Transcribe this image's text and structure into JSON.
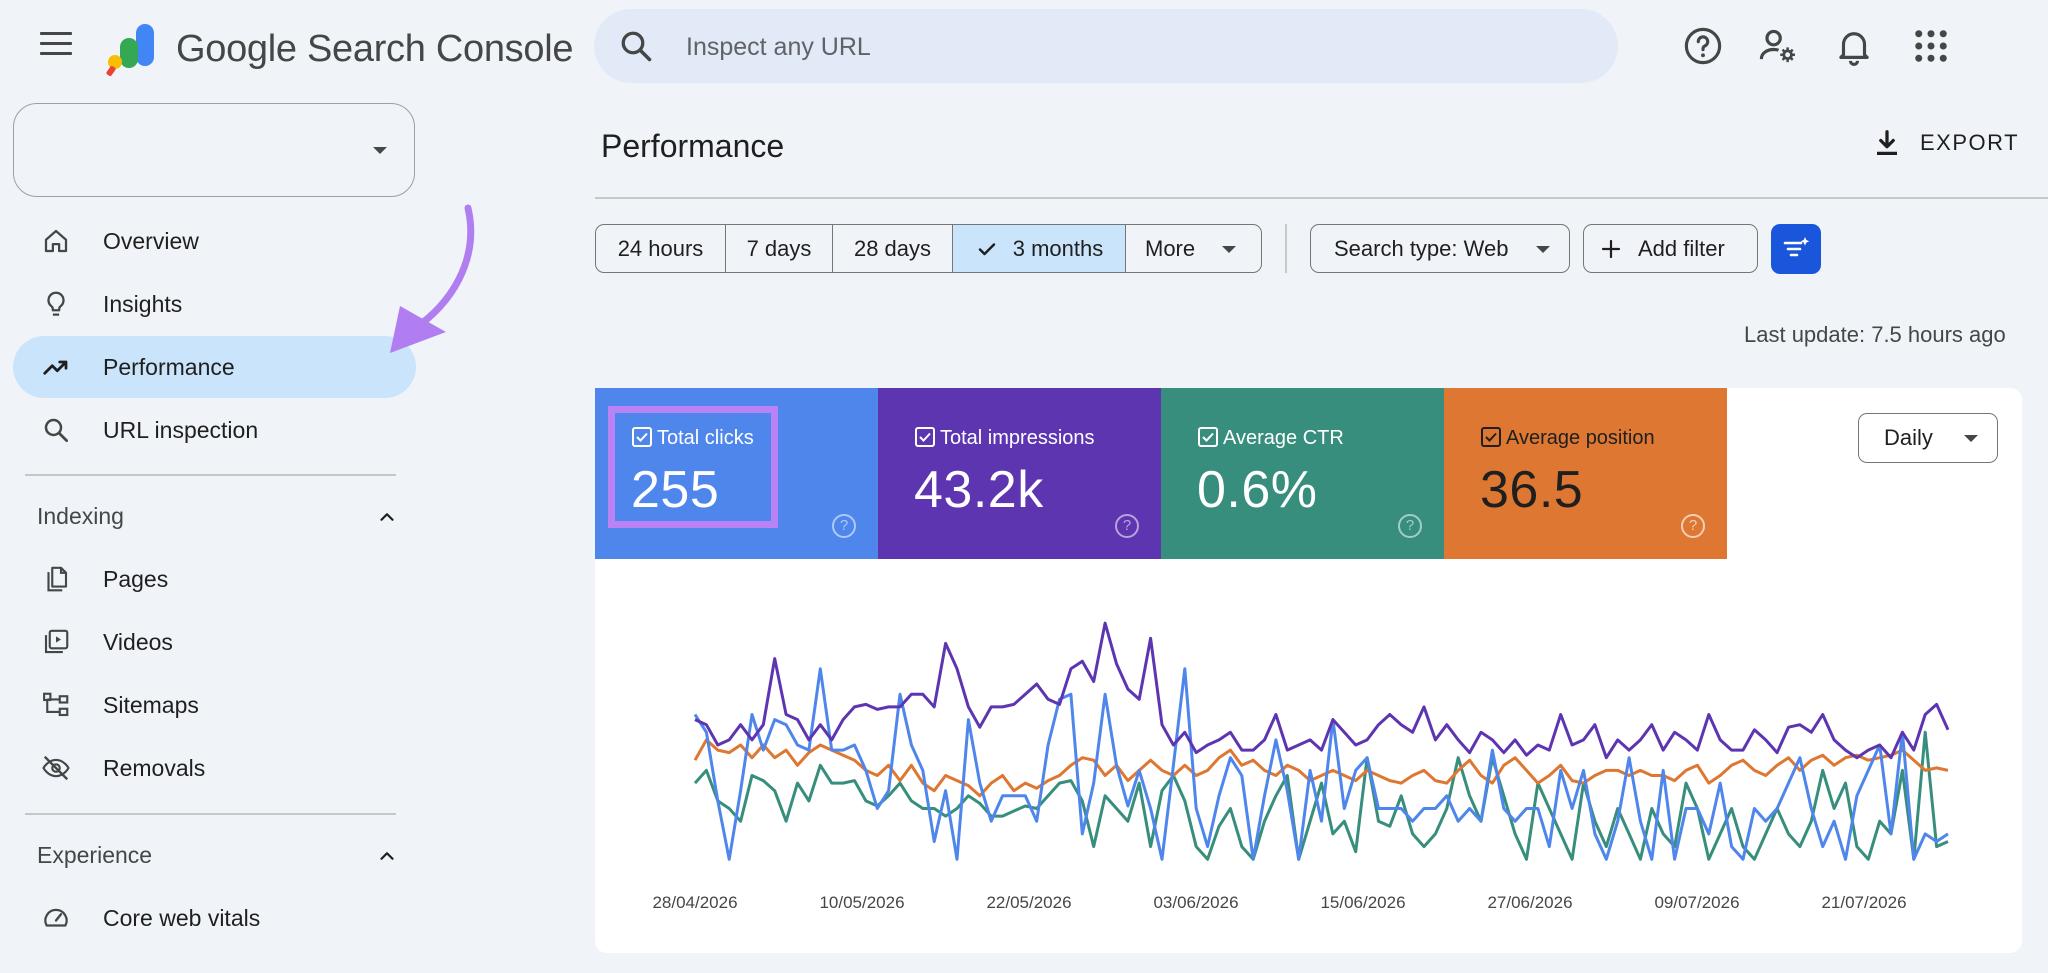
{
  "header": {
    "brand": "Google Search Console",
    "search_placeholder": "Inspect any URL",
    "icons": [
      "menu-icon",
      "help-icon",
      "manage-accounts-icon",
      "bell-icon",
      "apps-grid-icon"
    ]
  },
  "sidebar": {
    "property_value": "",
    "items": [
      {
        "label": "Overview",
        "icon": "home-icon",
        "active": false
      },
      {
        "label": "Insights",
        "icon": "lightbulb-icon",
        "active": false
      },
      {
        "label": "Performance",
        "icon": "trending-up-icon",
        "active": true
      },
      {
        "label": "URL inspection",
        "icon": "search-icon",
        "active": false
      }
    ],
    "indexing": {
      "title": "Indexing",
      "items": [
        {
          "label": "Pages",
          "icon": "pages-icon"
        },
        {
          "label": "Videos",
          "icon": "video-library-icon"
        },
        {
          "label": "Sitemaps",
          "icon": "sitemap-icon"
        },
        {
          "label": "Removals",
          "icon": "visibility-off-icon"
        }
      ]
    },
    "experience": {
      "title": "Experience",
      "items": [
        {
          "label": "Core web vitals",
          "icon": "speed-gauge-icon"
        }
      ]
    }
  },
  "main": {
    "title": "Performance",
    "export_label": "EXPORT",
    "date_ranges": [
      {
        "label": "24 hours",
        "selected": false
      },
      {
        "label": "7 days",
        "selected": false
      },
      {
        "label": "28 days",
        "selected": false
      },
      {
        "label": "3 months",
        "selected": true
      },
      {
        "label": "More",
        "selected": false
      }
    ],
    "search_type": "Search type: Web",
    "add_filter": "Add filter",
    "last_update": "Last update: 7.5 hours ago",
    "granularity": "Daily",
    "metrics": [
      {
        "label": "Total clicks",
        "value": "255",
        "color": "#4e86ec",
        "checked": true
      },
      {
        "label": "Total impressions",
        "value": "43.2k",
        "color": "#5e35b1",
        "checked": true
      },
      {
        "label": "Average CTR",
        "value": "0.6%",
        "color": "#388e7c",
        "checked": true
      },
      {
        "label": "Average position",
        "value": "36.5",
        "color": "#dd7731",
        "checked": true
      }
    ]
  },
  "chart_data": {
    "type": "line",
    "x_tick_labels": [
      "28/04/2026",
      "10/05/2026",
      "22/05/2026",
      "03/06/2026",
      "15/06/2026",
      "27/06/2026",
      "09/07/2026",
      "21/07/2026"
    ],
    "series": [
      {
        "name": "Total clicks",
        "color": "#4e86ec",
        "values": [
          0.62,
          0.55,
          0.28,
          0.05,
          0.32,
          0.62,
          0.48,
          0.6,
          0.58,
          0.5,
          0.48,
          0.8,
          0.48,
          0.48,
          0.5,
          0.4,
          0.25,
          0.32,
          0.7,
          0.5,
          0.4,
          0.12,
          0.32,
          0.05,
          0.6,
          0.35,
          0.2,
          0.3,
          0.3,
          0.3,
          0.2,
          0.5,
          0.68,
          0.7,
          0.15,
          0.35,
          0.7,
          0.42,
          0.26,
          0.4,
          0.25,
          0.05,
          0.42,
          0.8,
          0.25,
          0.1,
          0.3,
          0.45,
          0.38,
          0.05,
          0.3,
          0.52,
          0.32,
          0.05,
          0.4,
          0.2,
          0.6,
          0.25,
          0.4,
          0.45,
          0.25,
          0.25,
          0.25,
          0.2,
          0.25,
          0.25,
          0.3,
          0.2,
          0.25,
          0.2,
          0.48,
          0.25,
          0.2,
          0.25,
          0.25,
          0.1,
          0.4,
          0.25,
          0.4,
          0.15,
          0.05,
          0.2,
          0.45,
          0.2,
          0.05,
          0.4,
          0.05,
          0.25,
          0.25,
          0.15,
          0.35,
          0.1,
          0.05,
          0.25,
          0.2,
          0.25,
          0.35,
          0.45,
          0.25,
          0.1,
          0.2,
          0.05,
          0.3,
          0.4,
          0.5,
          0.15,
          0.55,
          0.05,
          0.15,
          0.12,
          0.15
        ]
      },
      {
        "name": "Total impressions",
        "color": "#5e35b1",
        "values": [
          0.6,
          0.58,
          0.5,
          0.52,
          0.58,
          0.52,
          0.58,
          0.84,
          0.62,
          0.6,
          0.52,
          0.58,
          0.52,
          0.6,
          0.65,
          0.66,
          0.64,
          0.65,
          0.65,
          0.7,
          0.7,
          0.65,
          0.9,
          0.8,
          0.65,
          0.57,
          0.65,
          0.65,
          0.66,
          0.7,
          0.74,
          0.68,
          0.66,
          0.8,
          0.83,
          0.75,
          0.98,
          0.82,
          0.72,
          0.68,
          0.92,
          0.58,
          0.5,
          0.55,
          0.47,
          0.5,
          0.52,
          0.55,
          0.48,
          0.48,
          0.52,
          0.62,
          0.48,
          0.5,
          0.52,
          0.48,
          0.6,
          0.55,
          0.5,
          0.52,
          0.58,
          0.62,
          0.58,
          0.55,
          0.65,
          0.52,
          0.58,
          0.52,
          0.47,
          0.55,
          0.52,
          0.47,
          0.52,
          0.46,
          0.5,
          0.48,
          0.62,
          0.5,
          0.52,
          0.58,
          0.45,
          0.52,
          0.48,
          0.52,
          0.58,
          0.48,
          0.55,
          0.52,
          0.48,
          0.62,
          0.52,
          0.48,
          0.48,
          0.56,
          0.52,
          0.47,
          0.57,
          0.58,
          0.55,
          0.62,
          0.52,
          0.48,
          0.45,
          0.48,
          0.5,
          0.45,
          0.55,
          0.48,
          0.62,
          0.66,
          0.56
        ]
      },
      {
        "name": "Average CTR",
        "color": "#388e7c",
        "values": [
          0.35,
          0.4,
          0.28,
          0.25,
          0.2,
          0.38,
          0.36,
          0.32,
          0.2,
          0.35,
          0.28,
          0.42,
          0.35,
          0.35,
          0.36,
          0.28,
          0.26,
          0.3,
          0.35,
          0.28,
          0.25,
          0.25,
          0.22,
          0.25,
          0.3,
          0.27,
          0.22,
          0.22,
          0.24,
          0.26,
          0.25,
          0.3,
          0.35,
          0.36,
          0.28,
          0.1,
          0.3,
          0.25,
          0.2,
          0.35,
          0.1,
          0.32,
          0.38,
          0.28,
          0.1,
          0.05,
          0.18,
          0.25,
          0.1,
          0.05,
          0.2,
          0.3,
          0.38,
          0.05,
          0.2,
          0.35,
          0.15,
          0.2,
          0.08,
          0.45,
          0.2,
          0.18,
          0.3,
          0.15,
          0.1,
          0.15,
          0.25,
          0.45,
          0.3,
          0.2,
          0.45,
          0.3,
          0.15,
          0.05,
          0.35,
          0.25,
          0.15,
          0.05,
          0.35,
          0.2,
          0.1,
          0.25,
          0.15,
          0.05,
          0.25,
          0.15,
          0.1,
          0.35,
          0.25,
          0.05,
          0.15,
          0.25,
          0.1,
          0.05,
          0.15,
          0.25,
          0.15,
          0.1,
          0.2,
          0.4,
          0.25,
          0.35,
          0.1,
          0.05,
          0.2,
          0.15,
          0.4,
          0.05,
          0.55,
          0.1,
          0.12
        ]
      },
      {
        "name": "Average position",
        "color": "#dd7731",
        "values": [
          0.44,
          0.52,
          0.48,
          0.47,
          0.5,
          0.45,
          0.5,
          0.45,
          0.48,
          0.42,
          0.47,
          0.5,
          0.48,
          0.46,
          0.44,
          0.4,
          0.38,
          0.42,
          0.36,
          0.42,
          0.35,
          0.32,
          0.38,
          0.36,
          0.34,
          0.3,
          0.35,
          0.38,
          0.32,
          0.35,
          0.33,
          0.36,
          0.38,
          0.42,
          0.45,
          0.44,
          0.38,
          0.42,
          0.36,
          0.4,
          0.44,
          0.4,
          0.38,
          0.42,
          0.38,
          0.4,
          0.45,
          0.48,
          0.42,
          0.44,
          0.4,
          0.38,
          0.42,
          0.4,
          0.36,
          0.38,
          0.4,
          0.38,
          0.36,
          0.4,
          0.38,
          0.36,
          0.35,
          0.38,
          0.4,
          0.36,
          0.35,
          0.4,
          0.44,
          0.38,
          0.35,
          0.42,
          0.45,
          0.4,
          0.35,
          0.38,
          0.42,
          0.36,
          0.35,
          0.38,
          0.4,
          0.4,
          0.38,
          0.4,
          0.38,
          0.38,
          0.36,
          0.4,
          0.42,
          0.35,
          0.38,
          0.42,
          0.44,
          0.4,
          0.38,
          0.42,
          0.45,
          0.4,
          0.44,
          0.46,
          0.42,
          0.45,
          0.46,
          0.44,
          0.45,
          0.46,
          0.48,
          0.44,
          0.4,
          0.41,
          0.4
        ]
      }
    ],
    "y_scale": "each series normalized 0–1 (no y-axis shown)",
    "grid": false
  }
}
